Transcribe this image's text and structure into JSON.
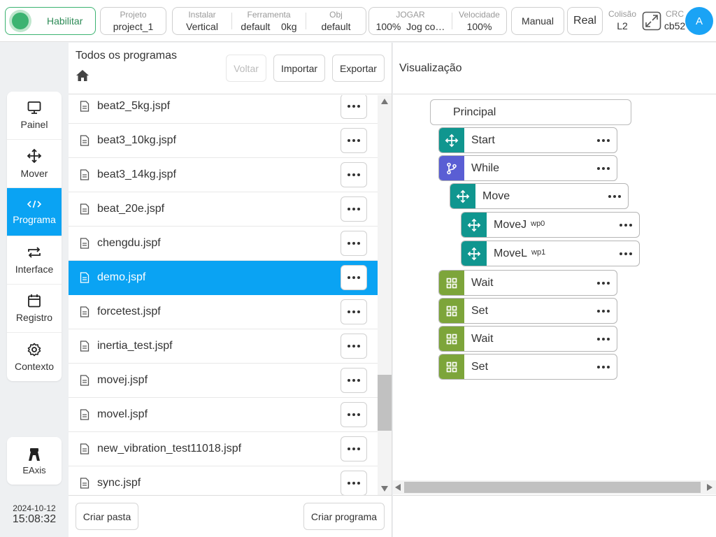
{
  "topbar": {
    "enable_label": "Habilitar",
    "project": {
      "label": "Projeto",
      "value": "project_1"
    },
    "install": {
      "label": "Instalar",
      "value": "Vertical"
    },
    "tool": {
      "label": "Ferramenta",
      "value": "default",
      "mass": "0kg"
    },
    "obj": {
      "label": "Obj",
      "value": "default"
    },
    "jog": {
      "label": "JOGAR",
      "percent": "100%",
      "mode": "Jog co…"
    },
    "speed": {
      "label": "Velocidade",
      "value": "100%"
    },
    "manual_label": "Manual",
    "real_label": "Real",
    "collision": {
      "label": "Colisão",
      "value": "L2"
    },
    "crc": {
      "label": "CRC",
      "value": "cb52"
    },
    "avatar_letter": "A"
  },
  "nav": {
    "items": [
      {
        "label": "Painel",
        "icon": "monitor-icon"
      },
      {
        "label": "Mover",
        "icon": "move-icon"
      },
      {
        "label": "Programa",
        "icon": "code-icon"
      },
      {
        "label": "Interface",
        "icon": "swap-icon"
      },
      {
        "label": "Registro",
        "icon": "calendar-icon"
      },
      {
        "label": "Contexto",
        "icon": "gear-icon"
      }
    ],
    "active": "Programa",
    "eaxis_label": "EAxis",
    "date": "2024-10-12",
    "time": "15:08:32"
  },
  "files": {
    "title": "Todos os programas",
    "back_label": "Voltar",
    "import_label": "Importar",
    "export_label": "Exportar",
    "items": [
      "beat2_5kg.jspf",
      "beat3_10kg.jspf",
      "beat3_14kg.jspf",
      "beat_20e.jspf",
      "chengdu.jspf",
      "demo.jspf",
      "forcetest.jspf",
      "inertia_test.jspf",
      "movej.jspf",
      "movel.jspf",
      "new_vibration_test11018.jspf",
      "sync.jspf"
    ],
    "selected": "demo.jspf",
    "create_folder_label": "Criar pasta",
    "create_program_label": "Criar programa"
  },
  "visualization": {
    "title": "Visualização",
    "root": "Principal",
    "nodes": [
      {
        "label": "Start",
        "sub": "",
        "icon": "move-icon",
        "color": "#10968f"
      },
      {
        "label": "While",
        "sub": "",
        "icon": "branch-icon",
        "color": "#5a5ed4"
      },
      {
        "label": "Move",
        "sub": "",
        "icon": "move-icon",
        "color": "#10968f"
      },
      {
        "label": "MoveJ",
        "sub": "wp0",
        "icon": "move-icon",
        "color": "#10968f"
      },
      {
        "label": "MoveL",
        "sub": "wp1",
        "icon": "move-icon",
        "color": "#10968f"
      },
      {
        "label": "Wait",
        "sub": "",
        "icon": "grid-icon",
        "color": "#7da53a"
      },
      {
        "label": "Set",
        "sub": "",
        "icon": "grid-icon",
        "color": "#7da53a"
      },
      {
        "label": "Wait",
        "sub": "",
        "icon": "grid-icon",
        "color": "#7da53a"
      },
      {
        "label": "Set",
        "sub": "",
        "icon": "grid-icon",
        "color": "#7da53a"
      }
    ]
  }
}
